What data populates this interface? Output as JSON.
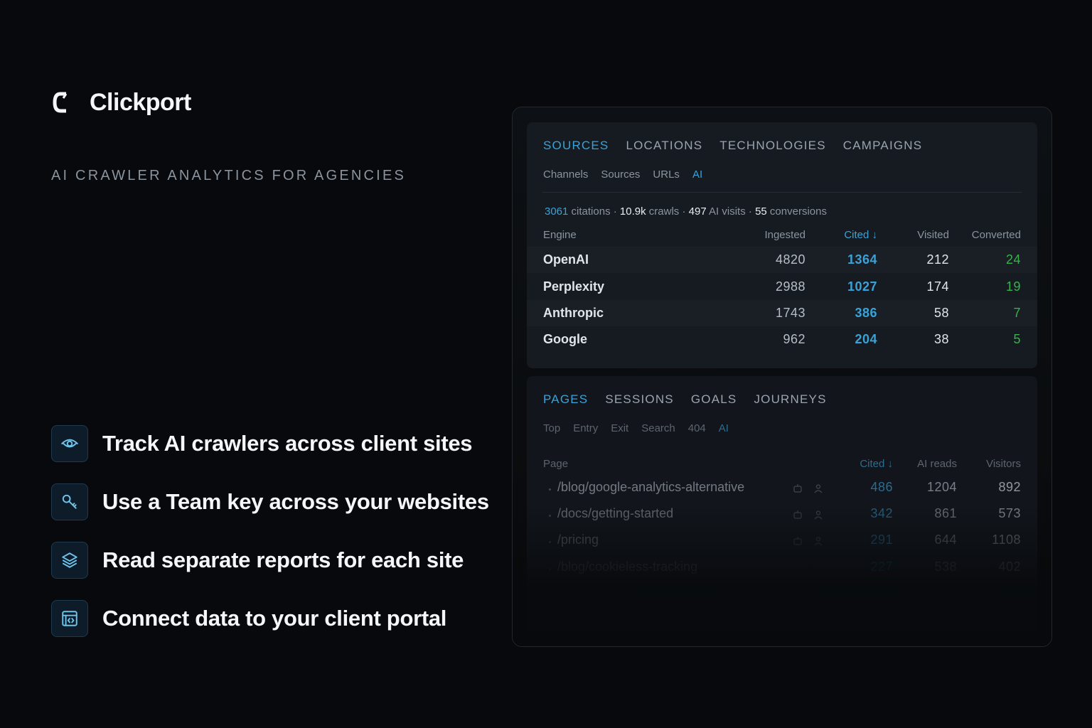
{
  "brand": {
    "name": "Clickport"
  },
  "tagline": "AI CRAWLER ANALYTICS FOR AGENCIES",
  "features": [
    {
      "icon": "eye-icon",
      "text": "Track AI crawlers across client sites"
    },
    {
      "icon": "key-icon",
      "text": "Use a Team key across your websites"
    },
    {
      "icon": "layers-icon",
      "text": "Read separate reports for each site"
    },
    {
      "icon": "code-window-icon",
      "text": "Connect data to your client portal"
    }
  ],
  "sources_card": {
    "tabs": [
      "SOURCES",
      "LOCATIONS",
      "TECHNOLOGIES",
      "CAMPAIGNS"
    ],
    "active_tab": "SOURCES",
    "subtabs": [
      "Channels",
      "Sources",
      "URLs",
      "AI"
    ],
    "active_subtab": "AI",
    "summary": {
      "citations": "3061",
      "citations_label": "citations",
      "crawls": "10.9k",
      "crawls_label": "crawls",
      "ai_visits": "497",
      "ai_visits_label": "AI visits",
      "conversions": "55",
      "conversions_label": "conversions",
      "separator": "·"
    },
    "columns": {
      "engine": "Engine",
      "ingested": "Ingested",
      "cited": "Cited ↓",
      "visited": "Visited",
      "converted": "Converted"
    },
    "rows": [
      {
        "engine": "OpenAI",
        "ingested": "4820",
        "cited": "1364",
        "visited": "212",
        "converted": "24"
      },
      {
        "engine": "Perplexity",
        "ingested": "2988",
        "cited": "1027",
        "visited": "174",
        "converted": "19"
      },
      {
        "engine": "Anthropic",
        "ingested": "1743",
        "cited": "386",
        "visited": "58",
        "converted": "7"
      },
      {
        "engine": "Google",
        "ingested": "962",
        "cited": "204",
        "visited": "38",
        "converted": "5"
      }
    ]
  },
  "pages_card": {
    "tabs": [
      "PAGES",
      "SESSIONS",
      "GOALS",
      "JOURNEYS"
    ],
    "active_tab": "PAGES",
    "subtabs": [
      "Top",
      "Entry",
      "Exit",
      "Search",
      "404",
      "AI"
    ],
    "active_subtab": "AI",
    "columns": {
      "page": "Page",
      "cited": "Cited ↓",
      "ai_reads": "AI reads",
      "visitors": "Visitors"
    },
    "rows": [
      {
        "page": "/blog/google-analytics-alternative",
        "cited": "486",
        "ai_reads": "1204",
        "visitors": "892"
      },
      {
        "page": "/docs/getting-started",
        "cited": "342",
        "ai_reads": "861",
        "visitors": "573"
      },
      {
        "page": "/pricing",
        "cited": "291",
        "ai_reads": "644",
        "visitors": "1108"
      },
      {
        "page": "/blog/cookieless-tracking",
        "cited": "227",
        "ai_reads": "538",
        "visitors": "402"
      }
    ]
  },
  "colors": {
    "accent": "#3aa2d8",
    "positive": "#37b34a",
    "background": "#07090c"
  }
}
